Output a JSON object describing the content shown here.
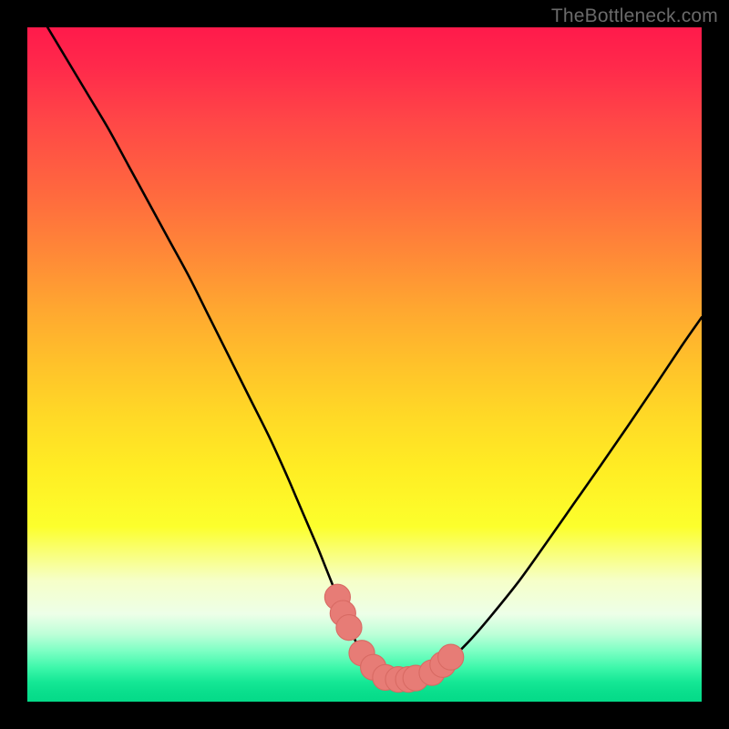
{
  "watermark": "TheBottleneck.com",
  "colors": {
    "frame": "#000000",
    "curve": "#000000",
    "marker_fill": "#e77c76",
    "marker_stroke": "#d86a63",
    "gradient_stops": [
      "#ff1a4b",
      "#ff2a4b",
      "#ff4747",
      "#ff6a3e",
      "#ff8a37",
      "#ffa830",
      "#ffc22a",
      "#ffda26",
      "#ffee24",
      "#fcff2c",
      "#f6ffc8",
      "#edffe8",
      "#bdffd8",
      "#7cffc4",
      "#3cf7aa",
      "#16e896",
      "#0adf8d",
      "#04da88"
    ]
  },
  "chart_data": {
    "type": "line",
    "title": "",
    "xlabel": "",
    "ylabel": "",
    "xlim": [
      0,
      100
    ],
    "ylim": [
      0,
      100
    ],
    "series": [
      {
        "name": "bottleneck-curve",
        "x": [
          3,
          6,
          9,
          12,
          15,
          18,
          21,
          24,
          27,
          30,
          33,
          36,
          38.5,
          40,
          41.5,
          43,
          44.4,
          45.8,
          47,
          48,
          49,
          50,
          50.9,
          51.6,
          52.4,
          53.2,
          54.4,
          55.6,
          56.7,
          57.8,
          60,
          63,
          66,
          69,
          73,
          77,
          81,
          85,
          89,
          93,
          97,
          100
        ],
        "y": [
          100,
          95,
          90,
          85,
          79.5,
          74,
          68.5,
          63,
          57,
          51,
          45,
          39,
          33.5,
          30,
          26.5,
          23,
          19.5,
          16,
          13,
          10.5,
          8.3,
          6.5,
          5.2,
          4.3,
          3.7,
          3.4,
          3.25,
          3.25,
          3.35,
          3.5,
          4.3,
          6.5,
          9.5,
          13,
          18,
          23.6,
          29.3,
          35,
          40.8,
          46.7,
          52.7,
          57
        ]
      }
    ],
    "markers": {
      "name": "highlight-dots",
      "x": [
        46.0,
        46.8,
        47.7,
        49.6,
        51.3,
        53.1,
        55.0,
        56.5,
        57.6,
        60.0,
        61.6,
        62.8
      ],
      "y": [
        15.5,
        13.1,
        11.0,
        7.2,
        5.1,
        3.6,
        3.3,
        3.3,
        3.5,
        4.3,
        5.5,
        6.6
      ],
      "r": 1.9
    }
  }
}
